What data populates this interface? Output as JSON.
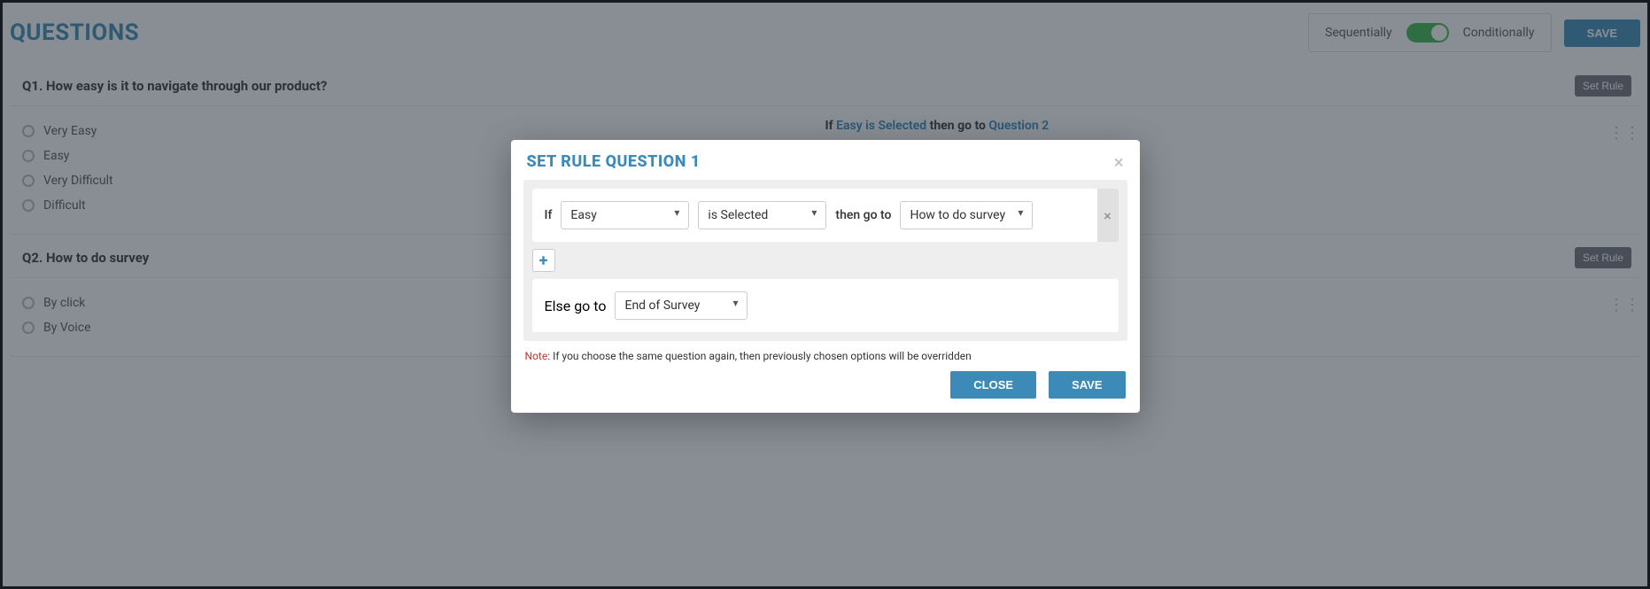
{
  "header": {
    "title": "QUESTIONS",
    "toggle_left": "Sequentially",
    "toggle_right": "Conditionally",
    "save": "SAVE"
  },
  "questions": [
    {
      "title": "Q1. How easy is it to navigate through our product?",
      "set_rule": "Set Rule",
      "options": [
        "Very Easy",
        "Easy",
        "Very Difficult",
        "Difficult"
      ],
      "preview_if": "If ",
      "preview_condition": "Easy is Selected",
      "preview_then": " then go to ",
      "preview_target": "Question 2"
    },
    {
      "title": "Q2. How to do survey",
      "set_rule": "Set Rule",
      "options": [
        "By click",
        "By Voice"
      ]
    }
  ],
  "modal": {
    "title": "SET RULE QUESTION 1",
    "lbl_if": "If",
    "sel_answer": "Easy",
    "sel_operator": "is Selected",
    "lbl_then": "then go to",
    "sel_target": "How to do survey",
    "add": "+",
    "lbl_else": "Else go to",
    "sel_else": "End of Survey",
    "note_label": "Note",
    "note_text": ": If you choose the same question again, then previously chosen options will be overridden",
    "close": "CLOSE",
    "save": "SAVE"
  }
}
